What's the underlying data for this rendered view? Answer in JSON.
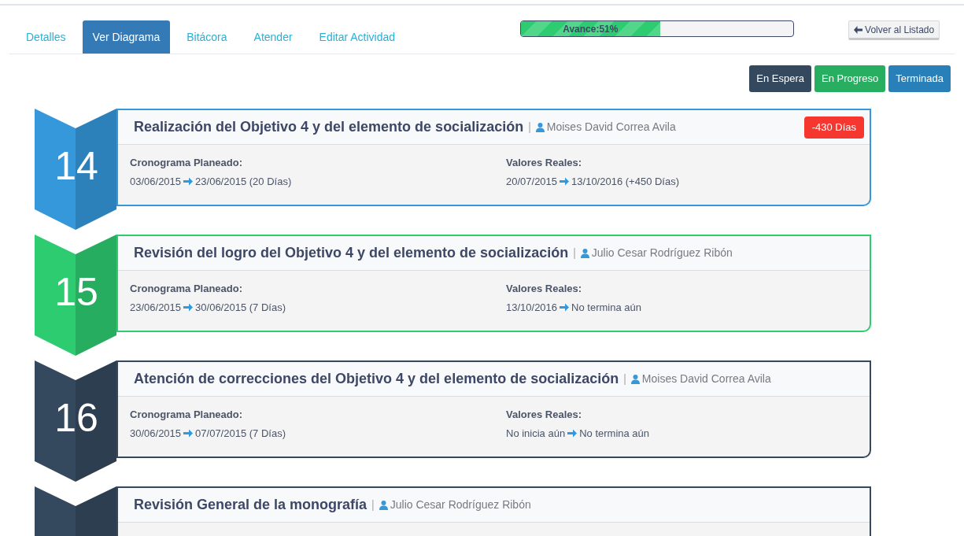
{
  "tabs": [
    {
      "label": "Detalles",
      "selected": false
    },
    {
      "label": "Ver Diagrama",
      "selected": true
    },
    {
      "label": "Bitácora",
      "selected": false
    },
    {
      "label": "Atender",
      "selected": false
    },
    {
      "label": "Editar Actividad",
      "selected": false
    }
  ],
  "progress": {
    "label": "Avance:51%",
    "level": 0.51
  },
  "back_button": {
    "label": "Volver al Listado"
  },
  "status_buttons": [
    {
      "label": "En Espera",
      "color": "#34495e"
    },
    {
      "label": "En Progreso",
      "color": "#27ae60"
    },
    {
      "label": "Terminada",
      "color": "#2980b9"
    }
  ],
  "activities": [
    {
      "number": "14",
      "color": "#3498db",
      "title": "Realización del Objetivo 4 y del elemento de socialización",
      "separator": "|",
      "person": "Moises David Correa Avila",
      "delay_badge": "-430 Días",
      "planned": {
        "heading": "Cronograma Planeado:",
        "start": "03/06/2015",
        "end": "23/06/2015 (20 Días)"
      },
      "actual": {
        "heading": "Valores Reales:",
        "start": "20/07/2015",
        "end": "13/10/2016 (+450 Días)"
      }
    },
    {
      "number": "15",
      "color": "#2ecc71",
      "title": "Revisión del logro del Objetivo 4 y del elemento de socialización",
      "separator": "|",
      "person": "Julio Cesar Rodríguez Ribón",
      "planned": {
        "heading": "Cronograma Planeado:",
        "start": "23/06/2015",
        "end": "30/06/2015 (7 Días)"
      },
      "actual": {
        "heading": "Valores Reales:",
        "start": "13/10/2016",
        "end": "No termina aún"
      }
    },
    {
      "number": "16",
      "color": "#34495e",
      "title": "Atención de correcciones del Objetivo 4 y del elemento de socialización",
      "separator": "|",
      "person": "Moises David Correa Avila",
      "planned": {
        "heading": "Cronograma Planeado:",
        "start": "30/06/2015",
        "end": "07/07/2015 (7 Días)"
      },
      "actual": {
        "heading": "Valores Reales:",
        "start": "No inicia aún",
        "end": "No termina aún"
      }
    },
    {
      "color": "#34495e",
      "title": "Revisión General de la monografía",
      "separator": "|",
      "person": "Julio Cesar Rodríguez Ribón"
    }
  ]
}
